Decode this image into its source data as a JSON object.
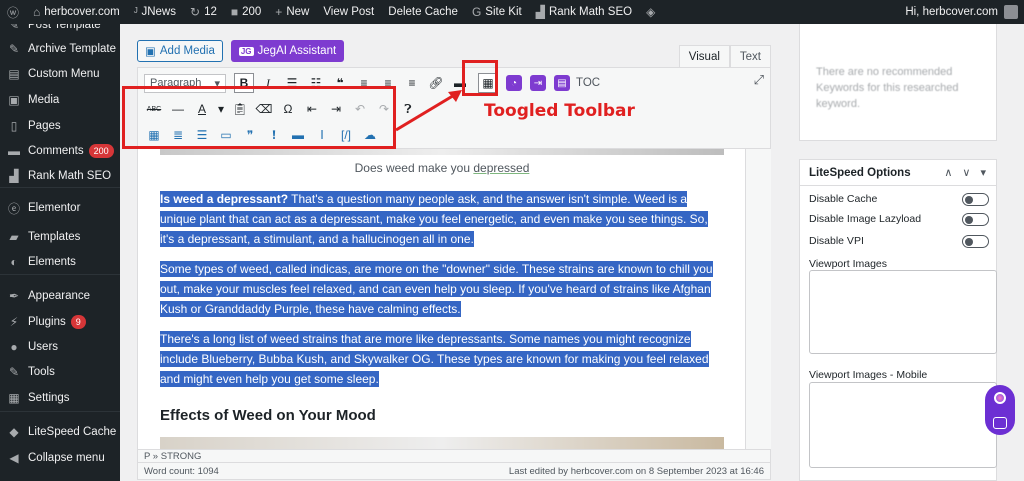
{
  "adminbar": {
    "site_name": "herbcover.com",
    "jnews": "JNews",
    "updates": "12",
    "comments": "200",
    "new_label": "New",
    "view_post": "View Post",
    "delete_cache": "Delete Cache",
    "site_kit": "Site Kit",
    "rank_math": "Rank Math SEO",
    "greeting": "Hi, herbcover.com"
  },
  "sidebar": {
    "items": [
      {
        "label": "Post Template",
        "icon": "wrench-icon"
      },
      {
        "label": "Archive Template",
        "icon": "wrench-icon"
      },
      {
        "label": "Custom Menu",
        "icon": "menu-icon"
      },
      {
        "label": "Media",
        "icon": "media-icon"
      },
      {
        "label": "Pages",
        "icon": "page-icon"
      },
      {
        "label": "Comments",
        "icon": "comment-icon",
        "badge": "200"
      },
      {
        "label": "Rank Math SEO",
        "icon": "chart-icon"
      },
      {
        "label": "Elementor",
        "icon": "elementor-icon"
      },
      {
        "label": "Templates",
        "icon": "folder-icon"
      },
      {
        "label": "Elements",
        "icon": "elements-icon"
      },
      {
        "label": "Appearance",
        "icon": "brush-icon"
      },
      {
        "label": "Plugins",
        "icon": "plug-icon",
        "badge": "9"
      },
      {
        "label": "Users",
        "icon": "user-icon"
      },
      {
        "label": "Tools",
        "icon": "tool-icon"
      },
      {
        "label": "Settings",
        "icon": "settings-icon"
      },
      {
        "label": "LiteSpeed Cache",
        "icon": "litespeed-icon"
      },
      {
        "label": "Collapse menu",
        "icon": "collapse-icon"
      }
    ]
  },
  "editor": {
    "add_media": "Add Media",
    "jegai": "JegAI Assistant",
    "tab_visual": "Visual",
    "tab_text": "Text",
    "paragraph_select": "Paragraph",
    "toc": "TOC",
    "annotation": "Toogled Toolbar",
    "caption_prefix": "Does weed make you ",
    "caption_link": "depressed",
    "p1_bold": "Is weed a depressant?",
    "p1_rest": " That's a question many people ask, and the answer isn't simple. Weed is a unique plant that can act as a depressant, make you feel energetic, and even make you see things. So, it's a depressant, a stimulant, and a hallucinogen all in one.",
    "p2": "Some types of weed, called indicas, are more on the \"downer\" side. These strains are known to chill you out, make your muscles feel relaxed, and can even help you sleep. If you've heard of strains like Afghan Kush or Granddaddy Purple, these have calming effects.",
    "p3": "There's a long list of weed strains that are more like depressants. Some names you might recognize include Blueberry, Bubba Kush, and Skywalker OG. These types are known for making you feel relaxed and might even help you get some sleep.",
    "h2": "Effects of Weed on Your Mood",
    "path": "P » STRONG",
    "word_count": "Word count: 1094",
    "last_edited": "Last edited by herbcover.com on 8 September 2023 at 16:46"
  },
  "keywords": {
    "empty_text": "There are no recommended Keywords for this researched keyword."
  },
  "litespeed": {
    "title": "LiteSpeed Options",
    "disable_cache": "Disable Cache",
    "disable_lazyload": "Disable Image Lazyload",
    "disable_vpi": "Disable VPI",
    "viewport_images": "Viewport Images",
    "viewport_images_mobile": "Viewport Images - Mobile"
  },
  "colors": {
    "admin_dark": "#1d2327",
    "selection": "#3566c4",
    "annotation": "#e02020",
    "jegai_purple": "#7e3bd0",
    "wp_blue": "#2271b1"
  }
}
